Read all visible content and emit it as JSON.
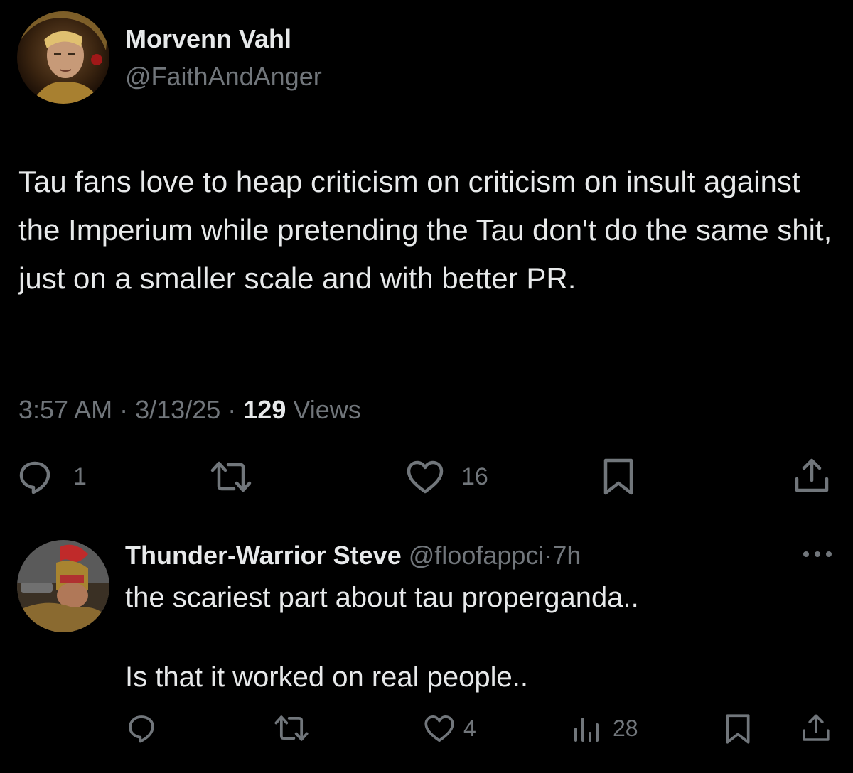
{
  "main_tweet": {
    "author_name": "Morvenn Vahl",
    "handle": "@FaithAndAnger",
    "text": "Tau fans love to heap criticism on criticism on insult against the Imperium while pretending the Tau don't do the same shit, just on a smaller scale and with better PR.",
    "time": "3:57 AM",
    "date": "3/13/25",
    "separator": "·",
    "views_count": "129",
    "views_label": "Views",
    "actions": {
      "reply_count": "1",
      "like_count": "16"
    }
  },
  "reply_tweet": {
    "author_name": "Thunder-Warrior Steve",
    "handle": "@floofappci",
    "separator": "·",
    "age": "7h",
    "line1": "the scariest part about tau properganda..",
    "line2": "Is that it worked on real people..",
    "actions": {
      "like_count": "4",
      "views_count": "28"
    }
  },
  "colors": {
    "background": "#000000",
    "text": "#e7e9ea",
    "muted": "#71767b",
    "divider": "#2f3336"
  }
}
